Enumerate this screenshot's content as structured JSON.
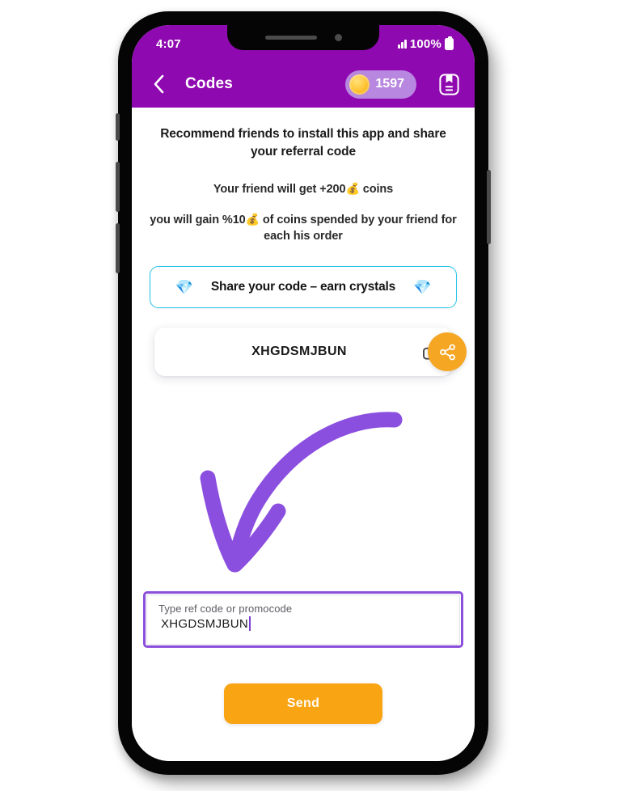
{
  "status_bar": {
    "time": "4:07",
    "battery_percent": "100%",
    "signal_icon": "signal-bars-icon",
    "battery_icon": "battery-icon"
  },
  "app_bar": {
    "back_icon": "chevron-left-icon",
    "title": "Codes",
    "coin_icon": "coin-icon",
    "coin_count": "1597",
    "bookmark_icon": "bookmark-icon"
  },
  "content": {
    "headline": "Recommend friends to install this app and share your referral code",
    "friend_bonus_prefix": "Your friend will get +200",
    "friend_bonus_emoji": "💰",
    "friend_bonus_suffix": "coins",
    "gain_prefix": "you will gain %10",
    "gain_emoji": "💰",
    "gain_suffix": "of coins spended by your friend for each his order",
    "share_cta_label": "Share your code – earn crystals",
    "gem_emoji": "💎",
    "referral_code": "XHGDSMJBUN",
    "copy_icon": "copy-icon",
    "share_icon": "share-nodes-icon",
    "arrow_icon": "curved-arrow-down-left-icon"
  },
  "promo_input": {
    "label": "Type ref code or promocode",
    "value": "XHGDSMJBUN",
    "placeholder": "Type ref code or promocode"
  },
  "actions": {
    "send_label": "Send"
  },
  "colors": {
    "brand_purple": "#8f09b0",
    "accent_orange": "#f5a623",
    "send_orange": "#f9a413",
    "cta_border_cyan": "#27c4e8",
    "input_focus_purple": "#8b4fdb",
    "arrow_purple": "#8b4fe0",
    "coin_gold": "#ffc83d"
  }
}
